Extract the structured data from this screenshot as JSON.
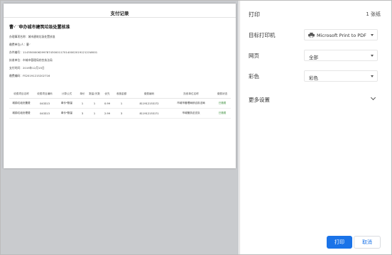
{
  "preview": {
    "document_title": "支付记录",
    "item_title": "曹·′  ′申办城市建筑垃圾处置核准",
    "meta": [
      "办理事项名称：城市建筑垃圾处置核准",
      "缴费单位/人：曹·′",
      "办件编号：114350000629978743000117014000201912121W001",
      "执收单位：市城市管理局综合执法局",
      "支付时间：2019年12月15日",
      "缴费编码：FS20191215202716"
    ],
    "table": {
      "headers": [
        "收费项目名称",
        "收费项目编码",
        "计算公式",
        "单价",
        "数量/天数",
        "优先",
        "收缴金额",
        "缴费编码",
        "执收单位名称",
        "缴费状态"
      ],
      "rows": [
        [
          "城镇垃圾处置费",
          "043313",
          "单价*数量",
          "1",
          "1",
          "0.99",
          "1",
          "8119121531?2",
          "市城市管理局综合执法局",
          "已缴费"
        ],
        [
          "城镇垃圾处理费",
          "043313",
          "单价*数量",
          "3",
          "1",
          "2.99",
          "3",
          "8119121531?1",
          "市城管执法支队",
          "已缴费"
        ]
      ]
    }
  },
  "settings": {
    "header": "打印",
    "sheet_count": "1 张纸",
    "destination_label": "目标打印机",
    "destination_value": "Microsoft Print to PDF",
    "pages_label": "网页",
    "pages_value": "全部",
    "color_label": "彩色",
    "color_value": "彩色",
    "more_settings": "更多设置",
    "print_button": "打印",
    "cancel_button": "取消"
  }
}
